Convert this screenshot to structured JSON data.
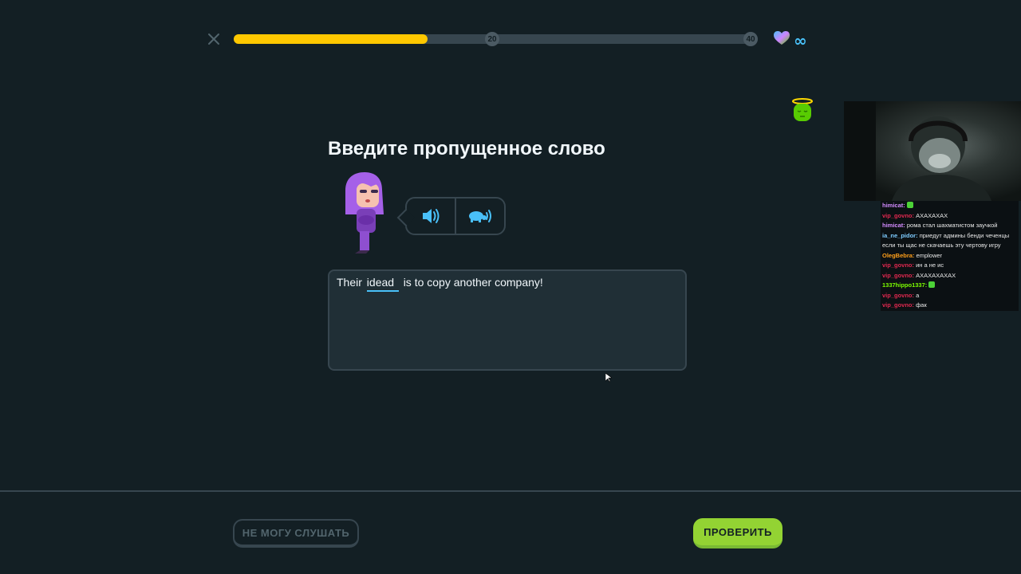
{
  "progress": {
    "fraction": 0.37,
    "milestones": [
      "20",
      "40"
    ],
    "hearts": "∞"
  },
  "question": {
    "title": "Введите пропущенное слово",
    "sentence_before": "Their",
    "typed_answer": "idead",
    "sentence_after": "is to copy another company!"
  },
  "footer": {
    "cant_listen_label": "НЕ МОГУ СЛУШАТЬ",
    "check_label": "ПРОВЕРИТЬ"
  },
  "colors": {
    "background": "#131f24",
    "progress_fill": "#ffc800",
    "check_button": "#93d333",
    "accent_blue": "#49c0f8"
  },
  "chat": [
    {
      "user": "himicat:",
      "color": "#d48cff",
      "message": "",
      "emote": true
    },
    {
      "user": "vip_govno:",
      "color": "#e0284f",
      "message": "АХАХАХАХ"
    },
    {
      "user": "himicat:",
      "color": "#d48cff",
      "message": "рома стал шахматистом заучкой"
    },
    {
      "user": "ia_ne_pidor:",
      "color": "#7ecbff",
      "message": "приедут админы бенди чеченцы если ты щас не скачаешь эту чертову игру",
      "wrap": true
    },
    {
      "user": "OlegBebra:",
      "color": "#ff9f1a",
      "message": "emplower"
    },
    {
      "user": "vip_govno:",
      "color": "#e0284f",
      "message": "ин а не ис"
    },
    {
      "user": "vip_govno:",
      "color": "#e0284f",
      "message": "АХАХАХАХАХ"
    },
    {
      "user": "1337hippo1337:",
      "color": "#7cfc00",
      "message": "",
      "emote": true
    },
    {
      "user": "vip_govno:",
      "color": "#e0284f",
      "message": "а"
    },
    {
      "user": "vip_govno:",
      "color": "#e0284f",
      "message": "фак"
    }
  ]
}
